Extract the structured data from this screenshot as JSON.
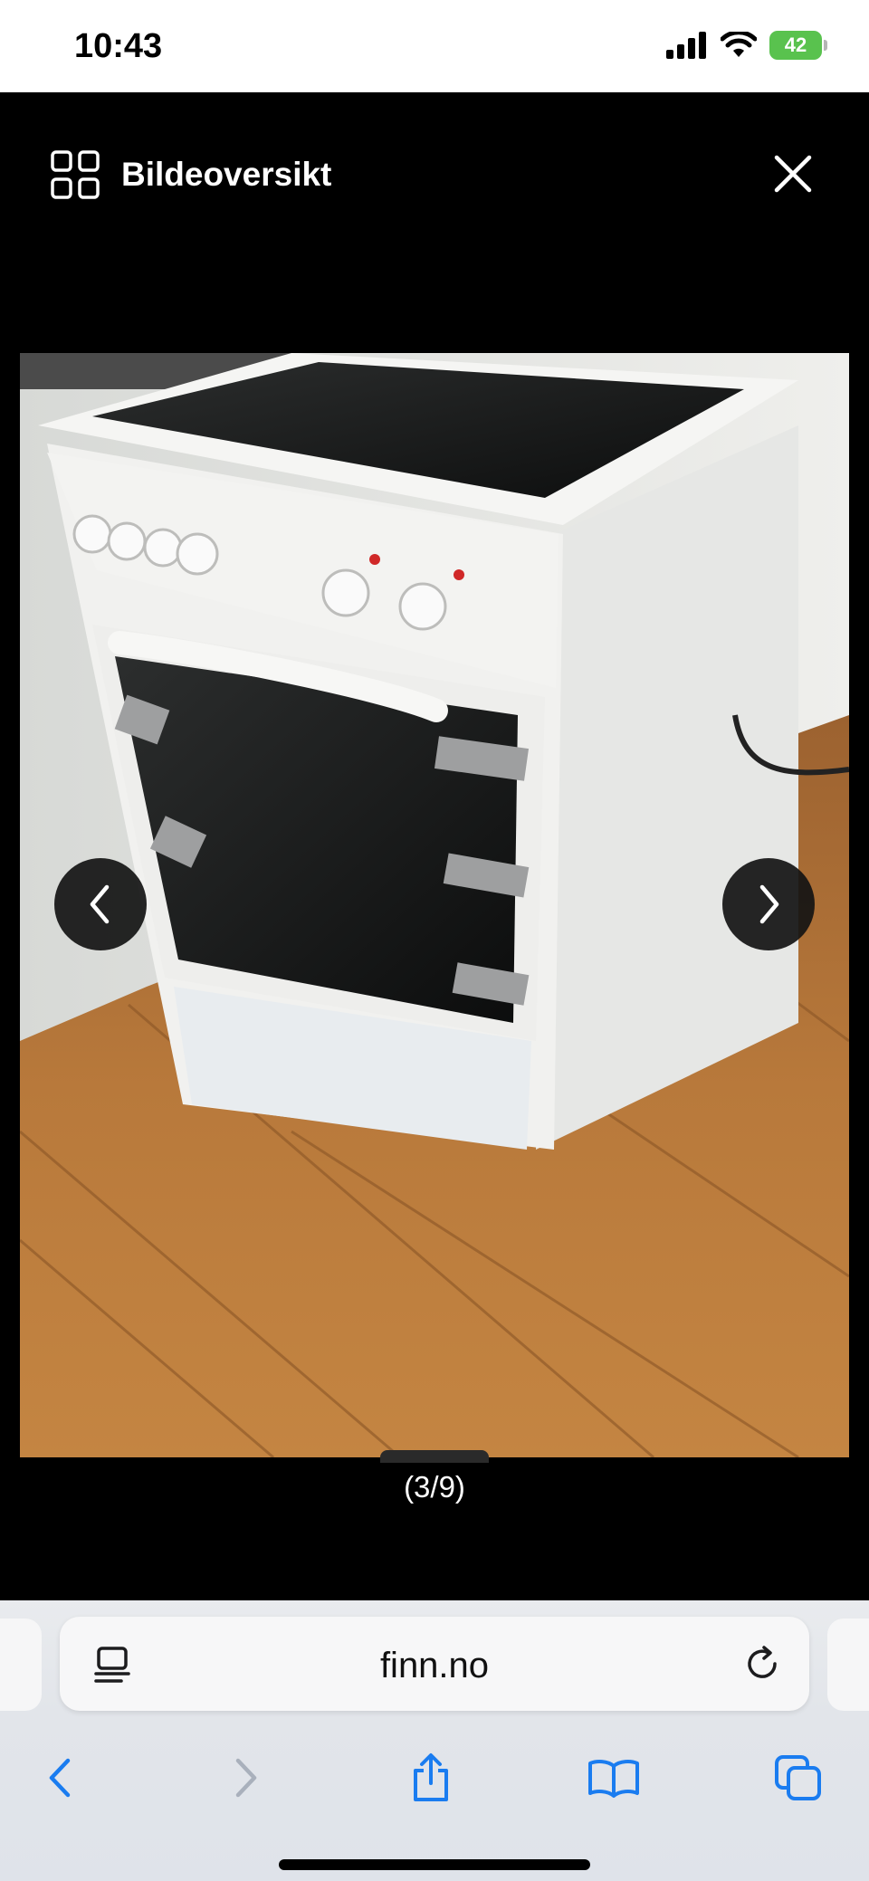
{
  "status_bar": {
    "time": "10:43",
    "battery": "42"
  },
  "viewer": {
    "overview_label": "Bildeoversikt",
    "counter": "(3/9)"
  },
  "browser": {
    "url": "finn.no"
  },
  "colors": {
    "accent": "#1a7cf0",
    "battery": "#59c24e",
    "background": "#000000"
  },
  "icons": [
    "grid-icon",
    "close-icon",
    "chevron-left-icon",
    "chevron-right-icon",
    "reader-icon",
    "reload-icon",
    "back-icon",
    "forward-icon",
    "share-icon",
    "bookmarks-icon",
    "tabs-icon"
  ]
}
